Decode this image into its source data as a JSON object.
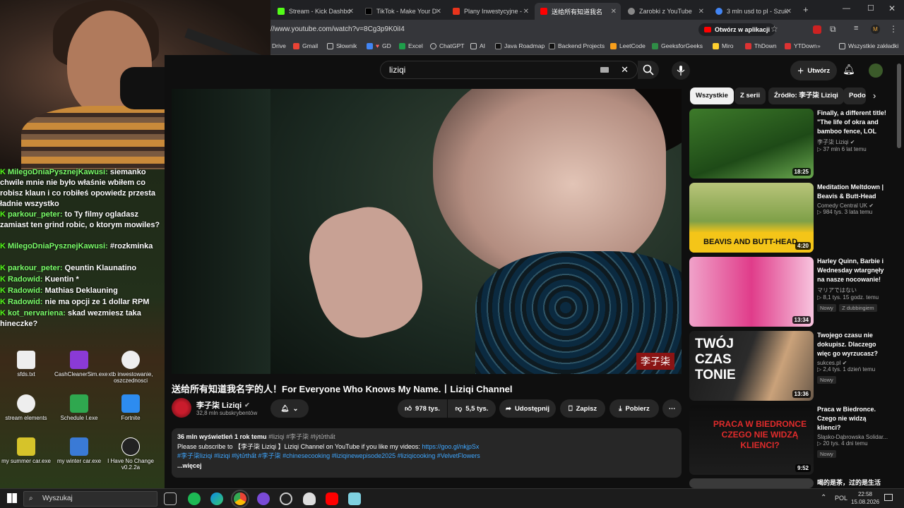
{
  "browser": {
    "tabs": [
      {
        "label": "Stream - Kick Dashbo",
        "color": "#53fc18"
      },
      {
        "label": "TikTok - Make Your D",
        "color": "#000000"
      },
      {
        "label": "Plany Inwestycyjne - ",
        "color": "#e8341c"
      },
      {
        "label": "送给所有知道我名",
        "color": "#ff0000"
      },
      {
        "label": "Zarobki z YouTube",
        "color": "#888888"
      },
      {
        "label": "3 mln usd to pl - Szuk",
        "color": "#4285f4"
      }
    ],
    "url": "//www.youtube.com/watch?v=8Cg3p9K0iI4",
    "open_in_app": "Otwórz w aplikacji",
    "bookmarks": [
      "Drive",
      "Gmail",
      "Słownik",
      "GD",
      "Excel",
      "ChatGPT",
      "AI",
      "Java Roadmap",
      "Backend Projects",
      "LeetCode",
      "GeeksforGeeks",
      "Miro",
      "ThDown",
      "YTDown",
      "Wszystkie zakładki"
    ]
  },
  "chat": [
    {
      "user": "MilegoDniaPysznejKawusi:",
      "msg": "siemanko chwile mnie nie było właśnie wbiłem co robisz klaun i co robiłeś opowiedz przesta ładnie wszystko"
    },
    {
      "user": "parkour_peter:",
      "msg": "to Ty filmy ogladasz zamiast ten grind robic, o ktorym mowiles?"
    },
    {
      "user": "MilegoDniaPysznejKawusi:",
      "msg": "#rozkminka"
    },
    {
      "user": "parkour_peter:",
      "msg": "Qeuntin Klaunatino"
    },
    {
      "user": "Radowid:",
      "msg": "Kuentin *"
    },
    {
      "user": "Radowid:",
      "msg": "Mathias Deklauning"
    },
    {
      "user": "Radowid:",
      "msg": "nie ma opcji ze 1 dollar RPM"
    },
    {
      "user": "kot_nervariena:",
      "msg": "skad wezmiesz taka hineczke?"
    }
  ],
  "desktop_icons": [
    "sfds.txt",
    "CashCleanerSim.exe",
    "xtb inwestowanie, oszczednosci",
    "stream elements",
    "Schedule I.exe",
    "Fortnite",
    "my summer car.exe",
    "my winter car.exe",
    "I Have No Change v0.2.2a"
  ],
  "youtube": {
    "search_query": "liziqi",
    "create_label": "Utwórz",
    "video": {
      "watermark": "李子柒",
      "title": "送给所有知道我名字的人！For Everyone Who Knows My Name.丨Liziqi Channel",
      "channel": "李子柒 Liziqi",
      "subscribers": "32,8 mln subskrybentów",
      "likes": "978 tys.",
      "dislikes": "5,5 tys.",
      "share": "Udostępnij",
      "save": "Zapisz",
      "download": "Pobierz",
      "desc_stats": "36 mln wyświetleń  1 rok temu",
      "desc_tags_top": "#liziqi #李子柒 #lýtửthất",
      "desc_line": "Please  subscribe to 【李子柒 Liziqi 】Liziqi Channel on YouTube if you like my videos:",
      "desc_link": "https://goo.gl/nkjpSx",
      "desc_tags": "#李子柒liziqi #liziqi #lýtửthất #李子柒 #chinesecooking #liziqinewepisode2025 #liziqicooking  #VelvetFlowers",
      "more": "...więcej"
    },
    "chips": [
      "Wszystkie",
      "Z serii",
      "Źródło: 李子柒 Liziqi",
      "Podo"
    ],
    "recommendations": [
      {
        "title": "Finally, a different title! \"The life of okra and bamboo fence, LOL这...",
        "channel": "李子柒 Liziqi",
        "stats": "▷ 37 mln  6 lat temu",
        "duration": "18:25",
        "badge": ""
      },
      {
        "title": "Meditation Meltdown | Beavis & Butt-Head",
        "channel": "Comedy Central UK",
        "stats": "▷ 984 tys.  3 lata temu",
        "duration": "4:20",
        "badge": "",
        "overlay": "BEAVIS AND BUTT-HEAD"
      },
      {
        "title": "Harley Quinn, Barbie i Wednesday wtargnęły na nasze nocowanie! ...",
        "channel": "マリアではない",
        "stats": "▷ 8,1 tys.  15 godz. temu",
        "duration": "13:34",
        "badge": "Nowy",
        "badge2": "Z dubbingiem"
      },
      {
        "title": "Twojego czasu nie dokupisz. Dlaczego więc go wyrzucasz?",
        "channel": "sukces.pl",
        "stats": "▷ 2,4 tys.  1 dzień temu",
        "duration": "13:36",
        "badge": "Nowy",
        "overlay": "TWÓJ CZAS TONIE"
      },
      {
        "title": "Praca w Biedronce. Czego nie widzą klienci?",
        "channel": "Śląsko-Dąbrowska Solidar...",
        "stats": "▷ 20 tys.  4 dni temu",
        "duration": "9:52",
        "badge": "Nowy",
        "overlay": "PRACA W BIEDRONCE CZEGO NIE WIDZĄ KLIENCI?"
      },
      {
        "title": "喝的是茶，过的是生活",
        "channel": "",
        "stats": "",
        "duration": "",
        "badge": ""
      }
    ]
  },
  "taskbar": {
    "search": "Wyszukaj",
    "lang": "POL",
    "time": "22:58",
    "date": "15.08.2026"
  }
}
